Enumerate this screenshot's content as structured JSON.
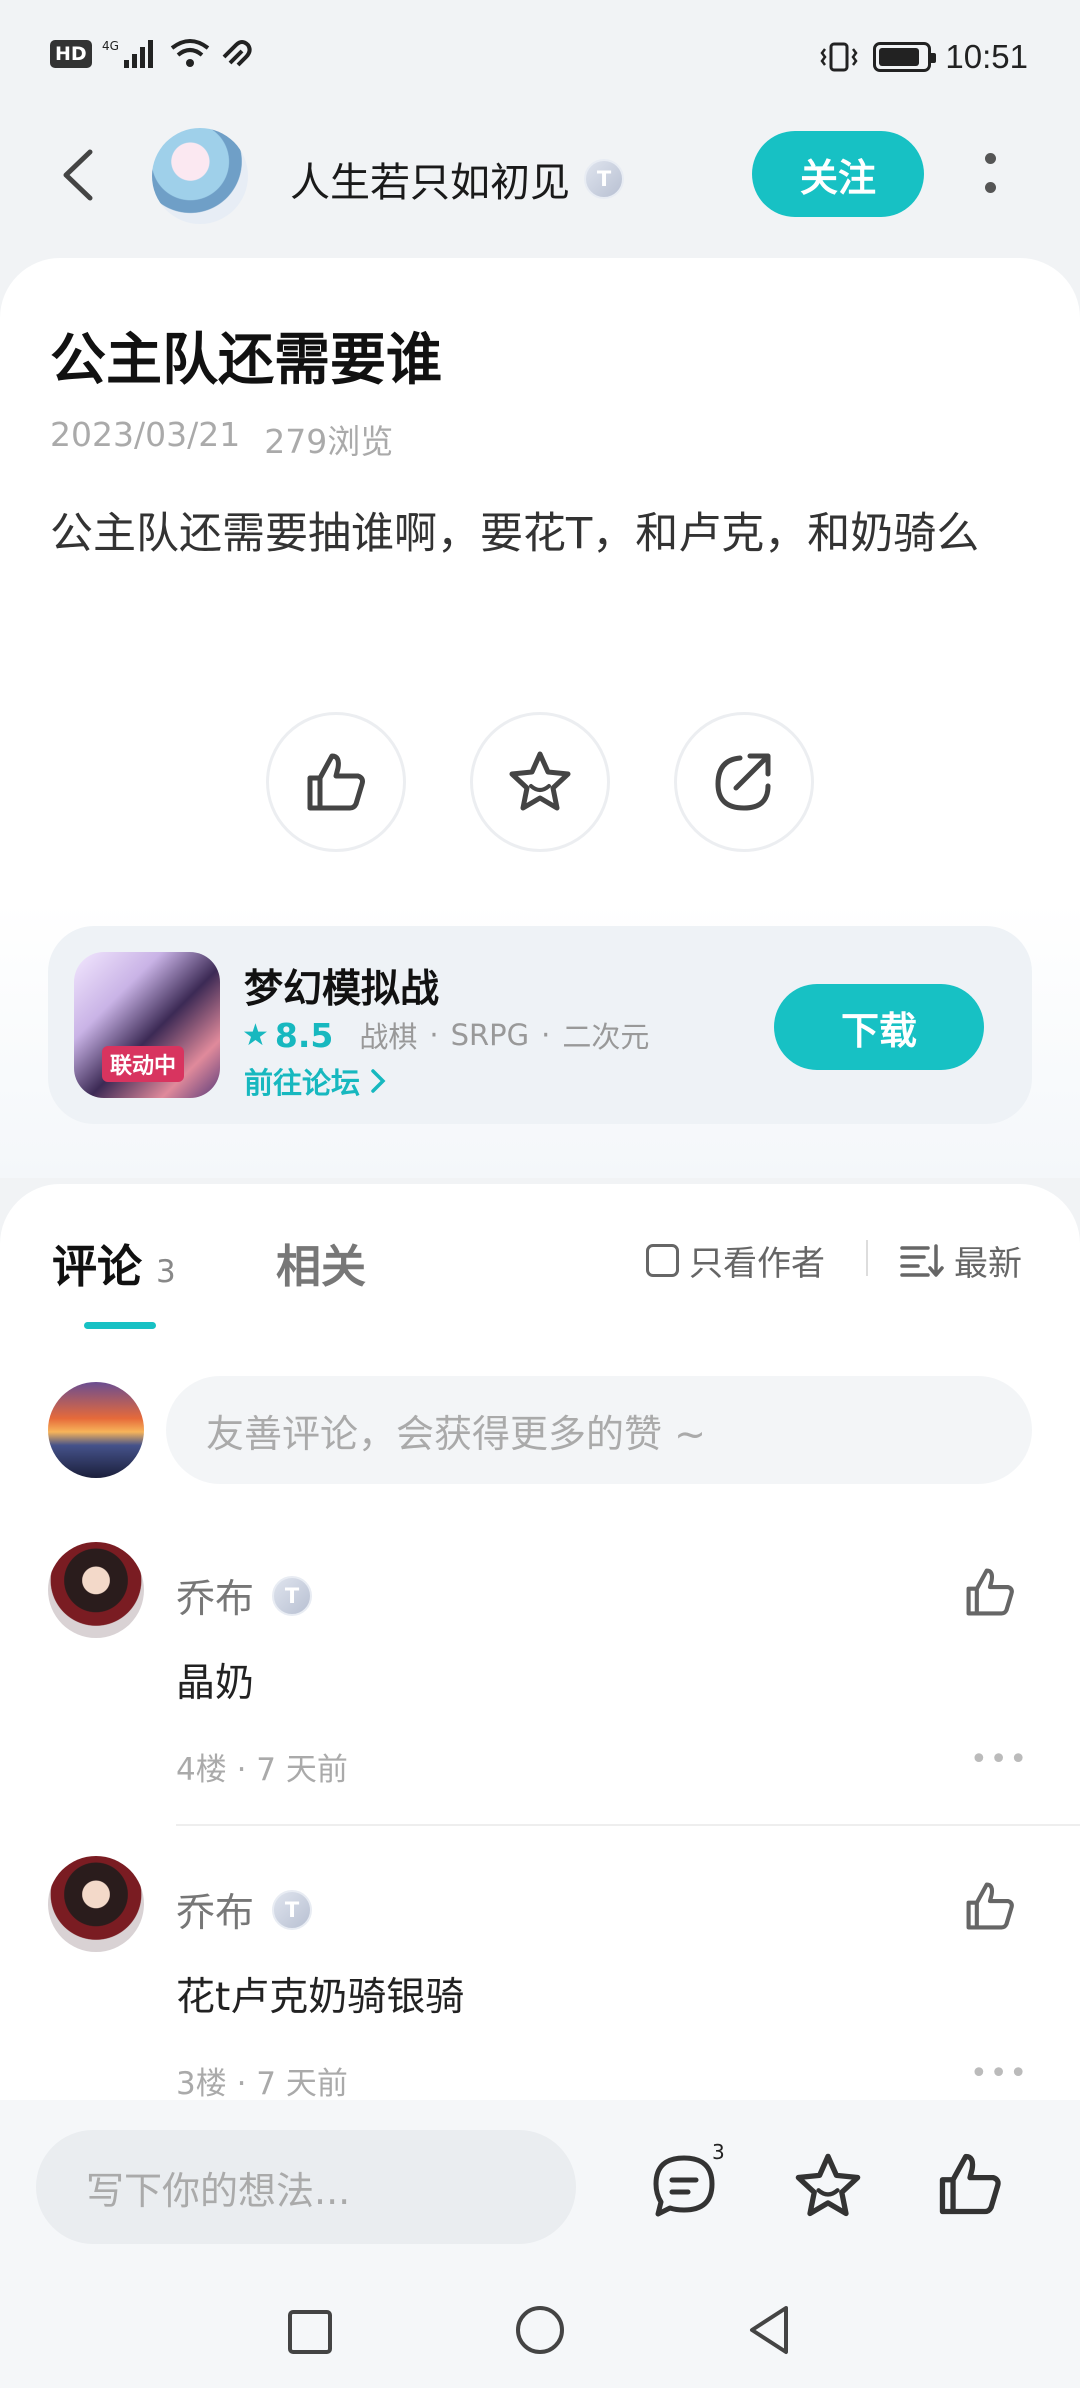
{
  "status_bar": {
    "hd": "HD",
    "network": "4G",
    "time": "10:51",
    "battery_level": 0.85
  },
  "header": {
    "username": "人生若只如初见",
    "level_badge": "T",
    "follow_label": "关注"
  },
  "post": {
    "title": "公主队还需要谁",
    "date": "2023/03/21",
    "views": "279浏览",
    "body": "公主队还需要抽谁啊，要花T，和卢克，和奶骑么"
  },
  "game": {
    "name": "梦幻模拟战",
    "rating": "8.5",
    "tags": [
      "战棋",
      "SRPG",
      "二次元"
    ],
    "forum_link": "前往论坛",
    "download_label": "下载",
    "icon_tag": "联动中"
  },
  "tabs": {
    "comments_label": "评论",
    "comments_count": "3",
    "related_label": "相关",
    "author_only_label": "只看作者",
    "sort_label": "最新"
  },
  "comment_input": {
    "placeholder": "友善评论，会获得更多的赞 ~"
  },
  "comments": [
    {
      "user": "乔布",
      "badge": "T",
      "text": "晶奶",
      "meta": "4楼 · 7 天前"
    },
    {
      "user": "乔布",
      "badge": "T",
      "text": "花t卢克奶骑银骑",
      "meta": "3楼 · 7 天前"
    }
  ],
  "bottom_bar": {
    "placeholder": "写下你的想法...",
    "comment_count": "3"
  },
  "colors": {
    "accent": "#17c1c4",
    "background": "#f1f3f5"
  },
  "icons": [
    "back-arrow-icon",
    "more-vertical-icon",
    "thumbs-up-icon",
    "star-icon",
    "share-icon",
    "chevron-right-icon",
    "sort-icon",
    "comment-icon",
    "square-nav-icon",
    "circle-nav-icon",
    "triangle-nav-icon"
  ]
}
